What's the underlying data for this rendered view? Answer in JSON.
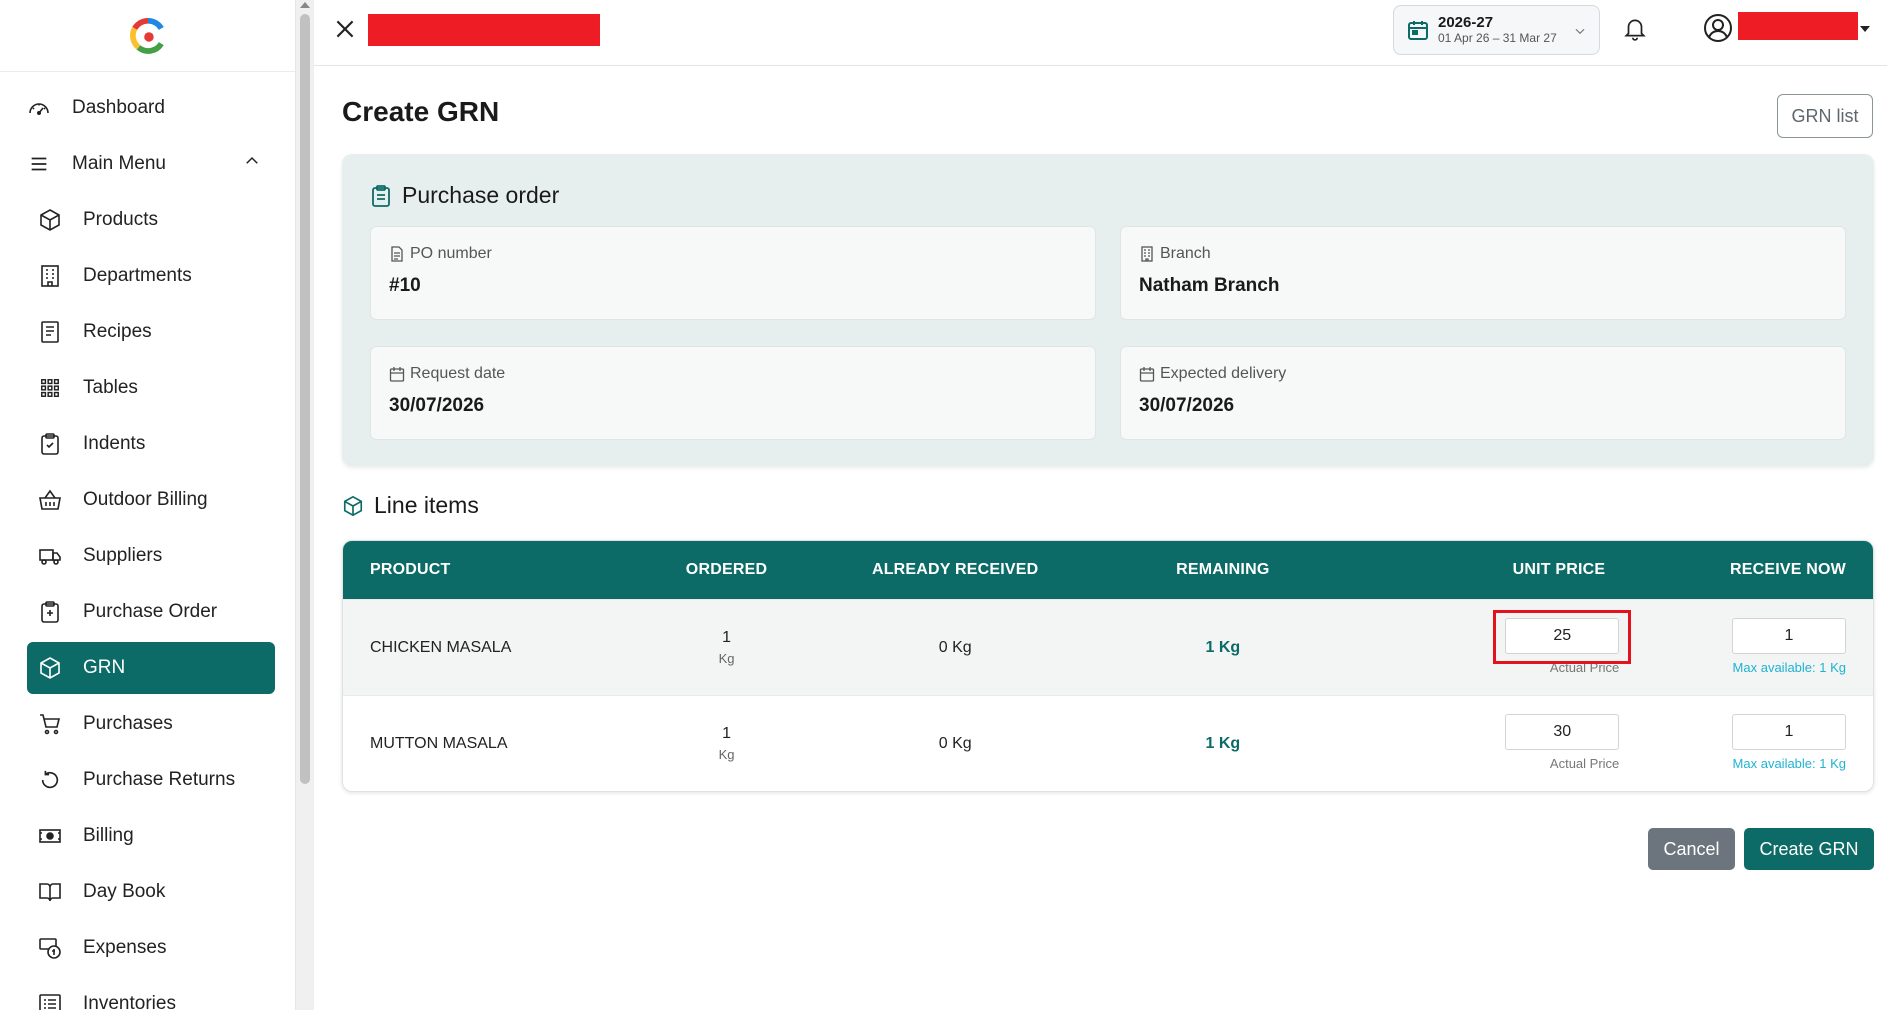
{
  "sidebar": {
    "items": [
      {
        "label": "Dashboard",
        "icon": "speedometer-icon"
      },
      {
        "label": "Main Menu",
        "icon": "menu-icon"
      },
      {
        "label": "Products",
        "icon": "box-icon"
      },
      {
        "label": "Departments",
        "icon": "building-icon"
      },
      {
        "label": "Recipes",
        "icon": "receipt-icon"
      },
      {
        "label": "Tables",
        "icon": "grid-icon"
      },
      {
        "label": "Indents",
        "icon": "clipboard-icon"
      },
      {
        "label": "Outdoor Billing",
        "icon": "basket-icon"
      },
      {
        "label": "Suppliers",
        "icon": "truck-icon"
      },
      {
        "label": "Purchase Order",
        "icon": "clipboard-check-icon"
      },
      {
        "label": "GRN",
        "icon": "box-icon",
        "active": true
      },
      {
        "label": "Purchases",
        "icon": "cart-icon"
      },
      {
        "label": "Purchase Returns",
        "icon": "return-icon"
      },
      {
        "label": "Billing",
        "icon": "cash-icon"
      },
      {
        "label": "Day Book",
        "icon": "book-icon"
      },
      {
        "label": "Expenses",
        "icon": "coins-icon"
      },
      {
        "label": "Inventories",
        "icon": "list-icon"
      }
    ]
  },
  "topbar": {
    "fiscal_year": "2026-27",
    "fiscal_range": "01 Apr 26 – 31 Mar 27"
  },
  "page": {
    "title": "Create GRN",
    "grn_list_button": "GRN list"
  },
  "purchase_order": {
    "heading": "Purchase order",
    "po_number_label": "PO number",
    "po_number": "#10",
    "branch_label": "Branch",
    "branch": "Natham Branch",
    "request_date_label": "Request date",
    "request_date": "30/07/2026",
    "expected_delivery_label": "Expected delivery",
    "expected_delivery": "30/07/2026"
  },
  "line_items": {
    "heading": "Line items",
    "columns": [
      "PRODUCT",
      "ORDERED",
      "ALREADY RECEIVED",
      "REMAINING",
      "UNIT PRICE",
      "RECEIVE NOW"
    ],
    "rows": [
      {
        "product": "CHICKEN MASALA",
        "ordered": "1",
        "ordered_unit": "Kg",
        "already_received": "0 Kg",
        "remaining": "1 Kg",
        "unit_price": "25",
        "price_note": "Actual Price",
        "receive_now": "1",
        "max_available": "Max available: 1 Kg"
      },
      {
        "product": "MUTTON MASALA",
        "ordered": "1",
        "ordered_unit": "Kg",
        "already_received": "0 Kg",
        "remaining": "1 Kg",
        "unit_price": "30",
        "price_note": "Actual Price",
        "receive_now": "1",
        "max_available": "Max available: 1 Kg"
      }
    ]
  },
  "actions": {
    "cancel": "Cancel",
    "create": "Create GRN"
  },
  "colors": {
    "brand": "#0c6b67",
    "redaction": "#ee1c25",
    "highlight": "#e3121d",
    "cancel": "#6c757d",
    "max_available": "#1fb3d2"
  }
}
